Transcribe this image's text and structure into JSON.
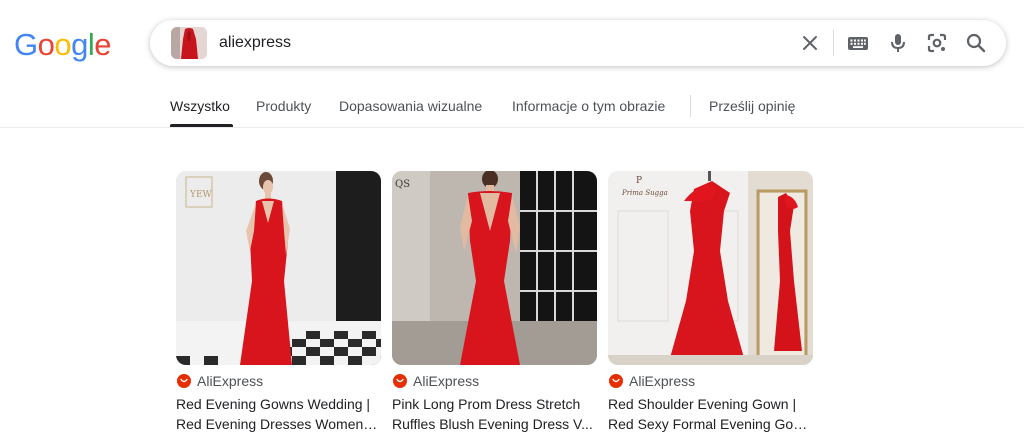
{
  "logo": {
    "letters": [
      "G",
      "o",
      "o",
      "g",
      "l",
      "e"
    ],
    "colors": [
      "#4285F4",
      "#EA4335",
      "#FBBC05",
      "#4285F4",
      "#34A853",
      "#EA4335"
    ]
  },
  "search": {
    "query": "aliexpress",
    "icons": [
      "close-icon",
      "keyboard-icon",
      "microphone-icon",
      "lens-icon",
      "search-icon"
    ]
  },
  "tabs": [
    {
      "label": "Wszystko",
      "active": true
    },
    {
      "label": "Produkty"
    },
    {
      "label": "Dopasowania wizualne"
    },
    {
      "label": "Informacje o tym obrazie"
    },
    {
      "label": "Prześlij opinię"
    }
  ],
  "results": [
    {
      "source": "AliExpress",
      "title_line1": "Red Evening Gowns Wedding |",
      "title_line2": "Red Evening Dresses Women | ..."
    },
    {
      "source": "AliExpress",
      "title_line1": "Pink Long Prom Dress Stretch",
      "title_line2": "Ruffles Blush Evening Dress V..."
    },
    {
      "source": "AliExpress",
      "title_line1": "Red Shoulder Evening Gown |",
      "title_line2": "Red Sexy Formal Evening Gow..."
    }
  ],
  "colors": {
    "accent_red": "#e62e04",
    "dress_red": "#d8141c",
    "text_secondary": "#4d5156"
  }
}
